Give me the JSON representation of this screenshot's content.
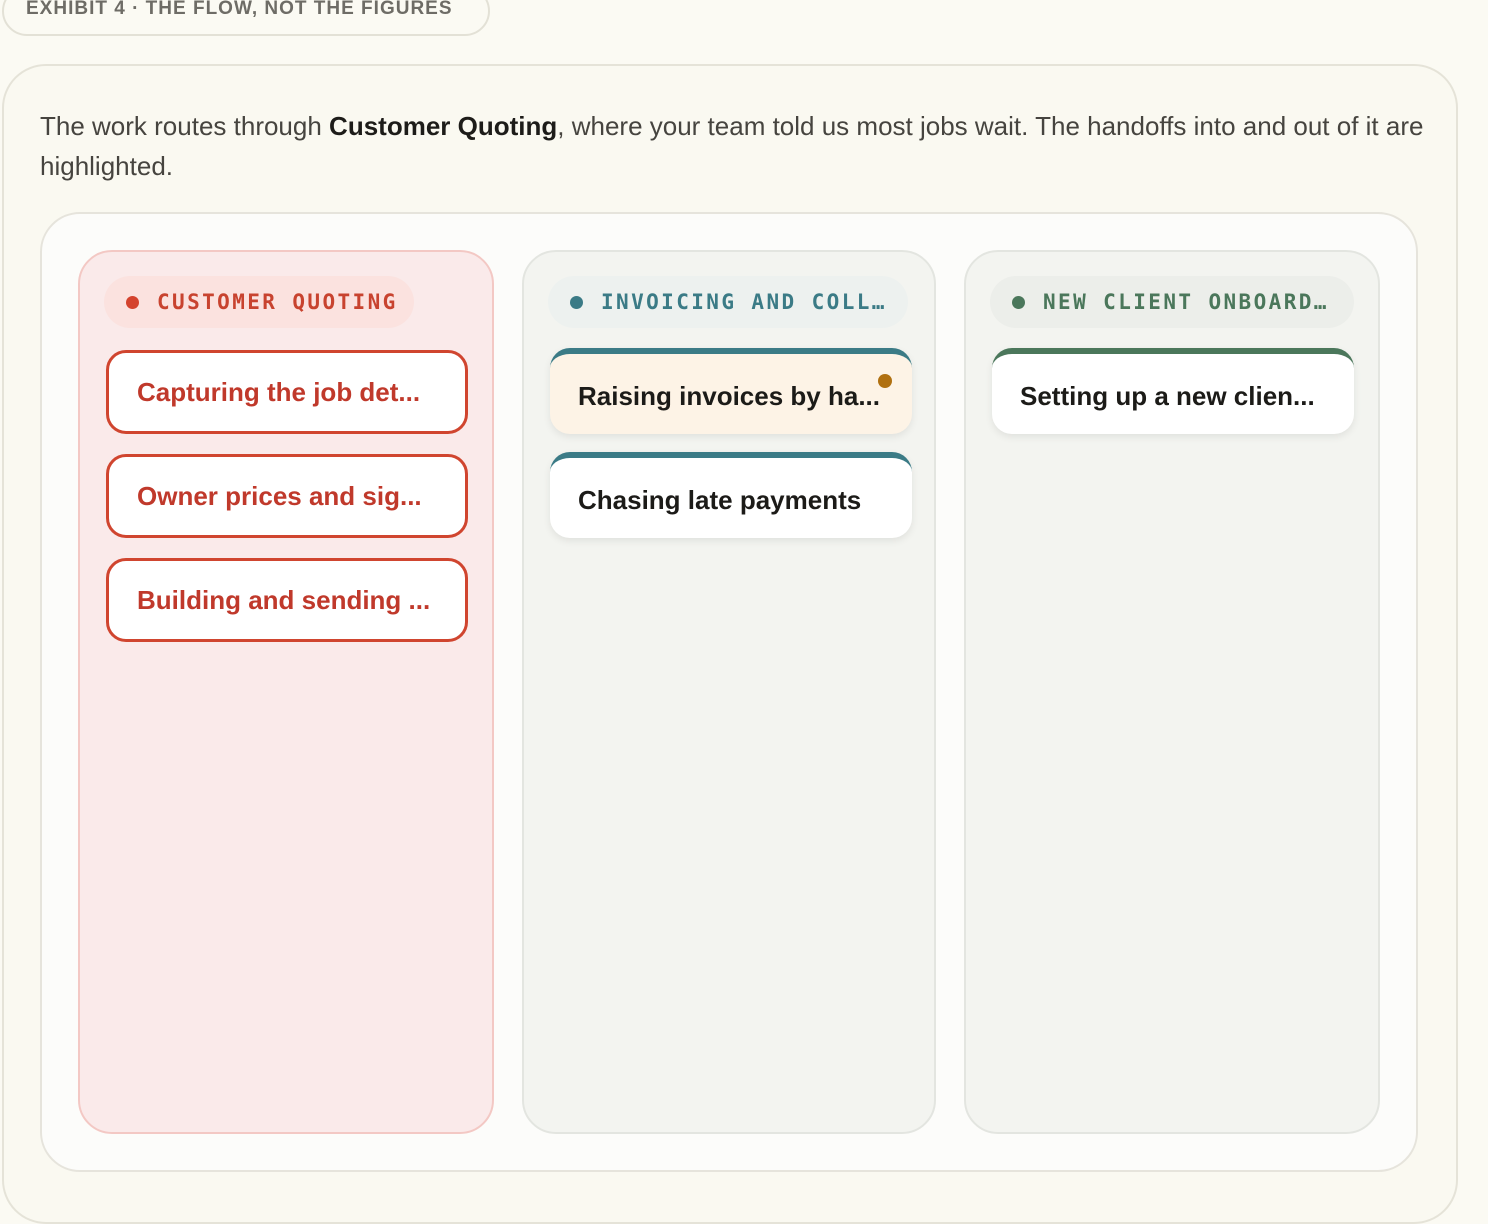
{
  "exhibit": {
    "label": "EXHIBIT 4 · THE FLOW, NOT THE FIGURES"
  },
  "intro": {
    "before": "The work routes through ",
    "highlight": "Customer Quoting",
    "after": ", where your team told us most jobs wait. The handoffs into and out of it are highlighted."
  },
  "columns": [
    {
      "title": "CUSTOMER QUOTING",
      "accent": "#d4432e",
      "highlighted": true,
      "cards": [
        {
          "label": "Capturing the job det..."
        },
        {
          "label": "Owner prices and sig..."
        },
        {
          "label": "Building and sending ..."
        }
      ]
    },
    {
      "title": "INVOICING AND COLL…",
      "accent": "#3b7b86",
      "highlighted": false,
      "cards": [
        {
          "label": "Raising invoices by ha...",
          "flagged": true
        },
        {
          "label": "Chasing late payments"
        }
      ]
    },
    {
      "title": "NEW CLIENT ONBOARD…",
      "accent": "#4b775b",
      "highlighted": false,
      "cards": [
        {
          "label": "Setting up a new clien..."
        }
      ]
    }
  ]
}
